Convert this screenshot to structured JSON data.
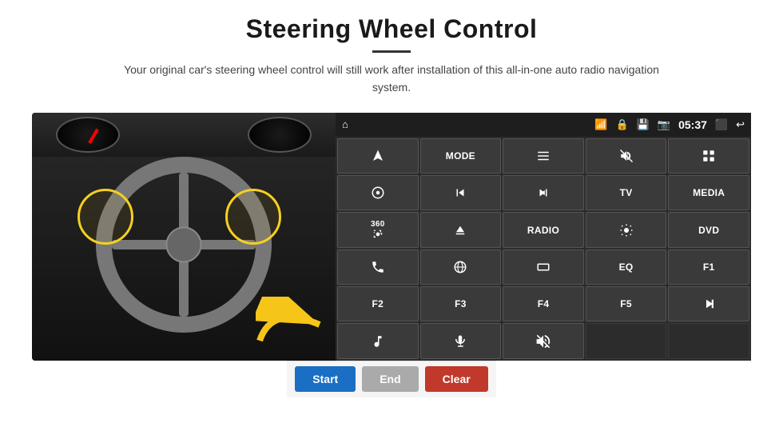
{
  "header": {
    "title": "Steering Wheel Control",
    "divider": true,
    "subtitle": "Your original car's steering wheel control will still work after installation of this all-in-one auto radio navigation system."
  },
  "status_bar": {
    "time": "05:37",
    "icons": [
      "wifi",
      "lock",
      "battery",
      "bluetooth",
      "signal",
      "mirror",
      "back"
    ]
  },
  "panel_buttons": [
    [
      {
        "type": "icon",
        "icon": "navigate",
        "label": ""
      },
      {
        "type": "text",
        "label": "MODE"
      },
      {
        "type": "icon",
        "icon": "list",
        "label": ""
      },
      {
        "type": "icon",
        "icon": "mute",
        "label": ""
      },
      {
        "type": "icon",
        "icon": "apps",
        "label": ""
      }
    ],
    [
      {
        "type": "icon",
        "icon": "settings-circle",
        "label": ""
      },
      {
        "type": "icon",
        "icon": "prev",
        "label": ""
      },
      {
        "type": "icon",
        "icon": "next",
        "label": ""
      },
      {
        "type": "text",
        "label": "TV"
      },
      {
        "type": "text",
        "label": "MEDIA"
      }
    ],
    [
      {
        "type": "icon",
        "icon": "360cam",
        "label": ""
      },
      {
        "type": "icon",
        "icon": "eject",
        "label": ""
      },
      {
        "type": "text",
        "label": "RADIO"
      },
      {
        "type": "icon",
        "icon": "brightness",
        "label": ""
      },
      {
        "type": "text",
        "label": "DVD"
      }
    ],
    [
      {
        "type": "icon",
        "icon": "phone",
        "label": ""
      },
      {
        "type": "icon",
        "icon": "globe",
        "label": ""
      },
      {
        "type": "icon",
        "icon": "rectangle",
        "label": ""
      },
      {
        "type": "text",
        "label": "EQ"
      },
      {
        "type": "text",
        "label": "F1"
      }
    ],
    [
      {
        "type": "text",
        "label": "F2"
      },
      {
        "type": "text",
        "label": "F3"
      },
      {
        "type": "text",
        "label": "F4"
      },
      {
        "type": "text",
        "label": "F5"
      },
      {
        "type": "icon",
        "icon": "play-pause",
        "label": ""
      }
    ],
    [
      {
        "type": "icon",
        "icon": "music",
        "label": ""
      },
      {
        "type": "icon",
        "icon": "mic",
        "label": ""
      },
      {
        "type": "icon",
        "icon": "speaker-phone",
        "label": ""
      },
      {
        "type": "empty",
        "label": ""
      },
      {
        "type": "empty",
        "label": ""
      }
    ]
  ],
  "bottom_buttons": {
    "start": "Start",
    "end": "End",
    "clear": "Clear"
  }
}
